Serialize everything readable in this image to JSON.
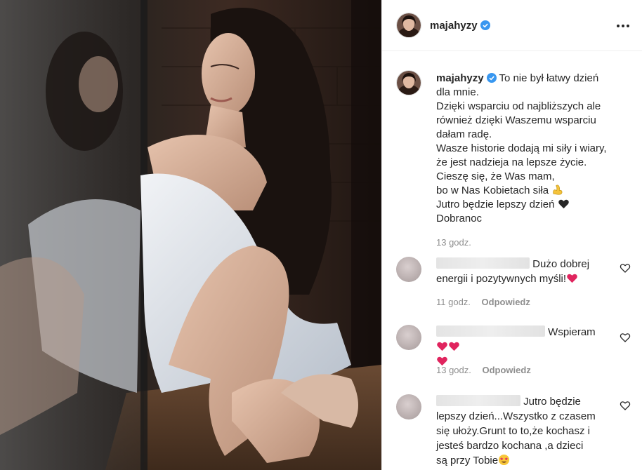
{
  "post": {
    "username": "majahyzy",
    "verified": true,
    "more_icon": "more-horizontal-icon"
  },
  "caption": {
    "username": "majahyzy",
    "lines": [
      "To nie był łatwy dzień",
      "dla mnie.",
      "Dzięki wsparciu od najbliższych ale",
      "również dzięki Waszemu wsparciu",
      "dałam radę.",
      "Wasze historie dodają mi siły i wiary,",
      "że jest nadzieja na lepsze życie.",
      "Cieszę się, że Was mam,",
      "bo w Nas Kobietach siła",
      "Jutro będzie lepszy dzień",
      "Dobranoc"
    ],
    "emoji_strength": "flexed-biceps-emoji",
    "emoji_heart": "black-heart-emoji",
    "time": "13 godz."
  },
  "comments": [
    {
      "lines": [
        "Dużo dobrej",
        "energii i pozytywnych myśli!"
      ],
      "emoji": "red-heart-emoji",
      "time": "11 godz.",
      "reply": "Odpowiedz"
    },
    {
      "lines": [
        "Wspieram"
      ],
      "emoji": "red-heart-emoji",
      "time": "13 godz.",
      "reply": "Odpowiedz"
    },
    {
      "lines": [
        "Jutro będzie",
        "lepszy dzień...Wszystko z czasem",
        "się ułoży.Grunt to to,że kochasz i",
        "jesteś bardzo kochana ,a dzieci",
        "są przy Tobie"
      ],
      "emoji": "star-struck-emoji"
    }
  ],
  "colors": {
    "verified": "#3897f0",
    "text": "#262626",
    "muted": "#8e8e8e",
    "heart_red": "#e0245e"
  }
}
